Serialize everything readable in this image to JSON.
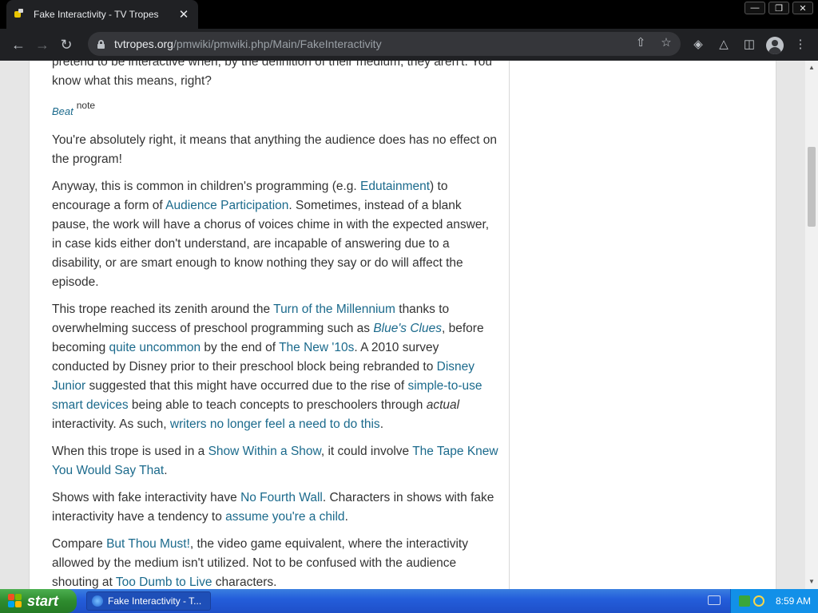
{
  "browser": {
    "tab_title": "Fake Interactivity - TV Tropes",
    "tab_close": "✕",
    "url_host": "tvtropes.org",
    "url_path": "/pmwiki/pmwiki.php/Main/FakeInteractivity",
    "window_buttons": {
      "minimize": "—",
      "restore": "❐",
      "close": "✕"
    }
  },
  "article": {
    "p0": {
      "t1": "pretend to be interactive when, by the definition of their medium, they aren't. You know what this means, right?"
    },
    "beat": {
      "label": "Beat",
      "note": "note"
    },
    "p1": {
      "t1": "You're absolutely right, it means that anything the audience does has no effect on the program!"
    },
    "p2": {
      "t1": "Anyway, this is common in children's programming (e.g. ",
      "a1": "Edutainment",
      "t2": ") to encourage a form of ",
      "a2": "Audience Participation",
      "t3": ". Sometimes, instead of a blank pause, the work will have a chorus of voices chime in with the expected answer, in case kids either don't understand, are incapable of answering due to a disability, or are smart enough to know nothing they say or do will affect the episode."
    },
    "p3": {
      "t1": "This trope reached its zenith around the ",
      "a1": "Turn of the Millennium",
      "t2": " thanks to overwhelming success of preschool programming such as ",
      "a2": "Blue's Clues",
      "t3": ", before becoming ",
      "a3": "quite uncommon",
      "t4": " by the end of ",
      "a4": "The New '10s",
      "t5": ". A 2010 survey conducted by Disney prior to their preschool block being rebranded to ",
      "a5": "Disney Junior",
      "t6": " suggested that this might have occurred due to the rise of ",
      "a6": "simple-to-use smart devices",
      "t7": " being able to teach concepts to preschoolers through ",
      "em": "actual",
      "t8": " interactivity. As such, ",
      "a7": "writers no longer feel a need to do this",
      "t9": "."
    },
    "p4": {
      "t1": "When this trope is used in a ",
      "a1": "Show Within a Show",
      "t2": ", it could involve ",
      "a2": "The Tape Knew You Would Say That",
      "t3": "."
    },
    "p5": {
      "t1": "Shows with fake interactivity have ",
      "a1": "No Fourth Wall",
      "t2": ". Characters in shows with fake interactivity have a tendency to ",
      "a2": "assume you're a child",
      "t3": "."
    },
    "p6": {
      "t1": "Compare ",
      "a1": "But Thou Must!",
      "t2": ", the video game equivalent, where the interactivity allowed by the medium isn't utilized. Not to be confused with the audience shouting at ",
      "a2": "Too Dumb to Live",
      "t3": " characters."
    }
  },
  "taskbar": {
    "start_label": "start",
    "task_label": "Fake Interactivity - T...",
    "clock": "8:59 AM"
  }
}
